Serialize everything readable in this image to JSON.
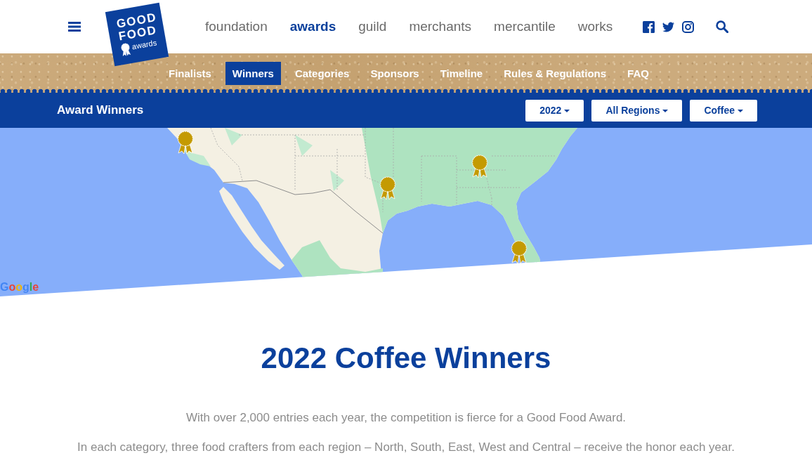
{
  "header": {
    "logo": {
      "lines": [
        "GOOD",
        "FOOD"
      ],
      "tagline": "awards"
    },
    "nav": [
      {
        "label": "foundation",
        "selected": false
      },
      {
        "label": "awards",
        "selected": true
      },
      {
        "label": "guild",
        "selected": false
      },
      {
        "label": "merchants",
        "selected": false
      },
      {
        "label": "mercantile",
        "selected": false
      },
      {
        "label": "works",
        "selected": false
      }
    ]
  },
  "subnav": [
    {
      "label": "Finalists",
      "selected": false
    },
    {
      "label": "Winners",
      "selected": true
    },
    {
      "label": "Categories",
      "selected": false
    },
    {
      "label": "Sponsors",
      "selected": false
    },
    {
      "label": "Timeline",
      "selected": false
    },
    {
      "label": "Rules & Regulations",
      "selected": false
    },
    {
      "label": "FAQ",
      "selected": false
    }
  ],
  "title_bar": {
    "title": "Award Winners",
    "filters": [
      "2022",
      "All Regions",
      "Coffee"
    ]
  },
  "map": {
    "attribution": "Google"
  },
  "intro": {
    "heading": "2022 Coffee Winners",
    "paragraphs": [
      "With over 2,000 entries each year, the competition is fierce for a Good Food Award.",
      "In each category, three food crafters from each region – North, South, East, West and Central – receive the honor each year."
    ]
  }
}
